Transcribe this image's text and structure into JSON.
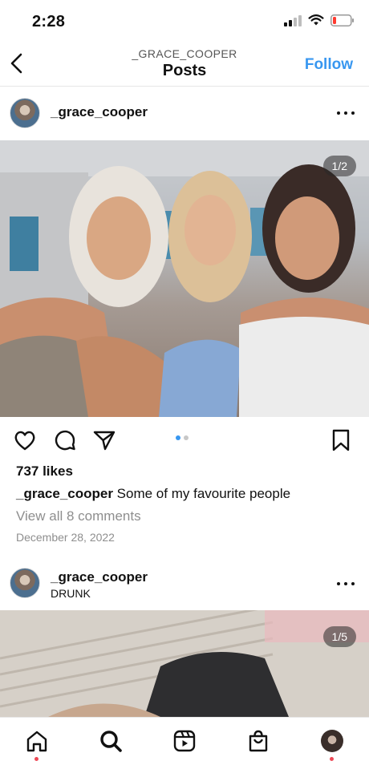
{
  "status": {
    "time": "2:28"
  },
  "nav": {
    "subtitle": "_GRACE_COOPER",
    "title": "Posts",
    "follow_label": "Follow"
  },
  "posts": [
    {
      "username": "_grace_cooper",
      "image_counter": "1/2",
      "likes": "737 likes",
      "caption_user": "_grace_cooper",
      "caption_text": " Some of my favourite people",
      "view_comments": "View all 8 comments",
      "date": "December 28, 2022"
    },
    {
      "username": "_grace_cooper",
      "location": "DRUNK",
      "image_counter": "1/5"
    }
  ],
  "carousel": {
    "total": 2,
    "active": 1
  },
  "bottom_nav": [
    "home-icon",
    "search-icon",
    "reels-icon",
    "shop-icon",
    "profile-avatar"
  ],
  "colors": {
    "accent": "#3897f0",
    "notification": "#ed4956"
  }
}
